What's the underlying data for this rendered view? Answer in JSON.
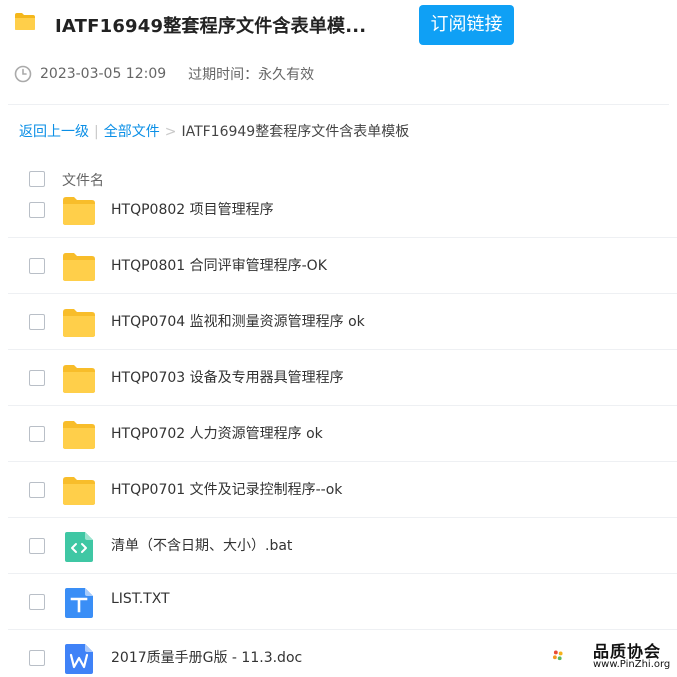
{
  "header": {
    "title": "IATF16949整套程序文件含表单模...",
    "subscribe_label": "订阅链接"
  },
  "meta": {
    "created": "2023-03-05 12:09",
    "expire": "过期时间：永久有效"
  },
  "breadcrumb": {
    "back": "返回上一级",
    "sep1": "|",
    "all": "全部文件",
    "sep2": ">",
    "current": "IATF16949整套程序文件含表单模板"
  },
  "columns": {
    "name": "文件名"
  },
  "files": [
    {
      "name": "HTQP0802 项目管理程序",
      "icon": "folder-icon"
    },
    {
      "name": "HTQP0801 合同评审管理程序-OK",
      "icon": "folder-icon"
    },
    {
      "name": "HTQP0704 监视和测量资源管理程序 ok",
      "icon": "folder-icon"
    },
    {
      "name": "HTQP0703 设备及专用器具管理程序",
      "icon": "folder-icon"
    },
    {
      "name": "HTQP0702 人力资源管理程序 ok",
      "icon": "folder-icon"
    },
    {
      "name": "HTQP0701 文件及记录控制程序--ok",
      "icon": "folder-icon"
    },
    {
      "name": "清单（不含日期、大小）.bat",
      "icon": "code-file-icon"
    },
    {
      "name": "LIST.TXT",
      "icon": "text-file-icon"
    },
    {
      "name": "2017质量手册G版 - 11.3.doc",
      "icon": "word-file-icon"
    }
  ],
  "watermark": {
    "name": "品质协会",
    "url": "www.PinZhi.org"
  },
  "colors": {
    "accent": "#0fa0f5",
    "link": "#0b8fe6",
    "folder": "#ffcf4a",
    "code_file": "#3fc7a4",
    "text_file": "#3a8ef6",
    "word_file": "#3f82f7"
  }
}
